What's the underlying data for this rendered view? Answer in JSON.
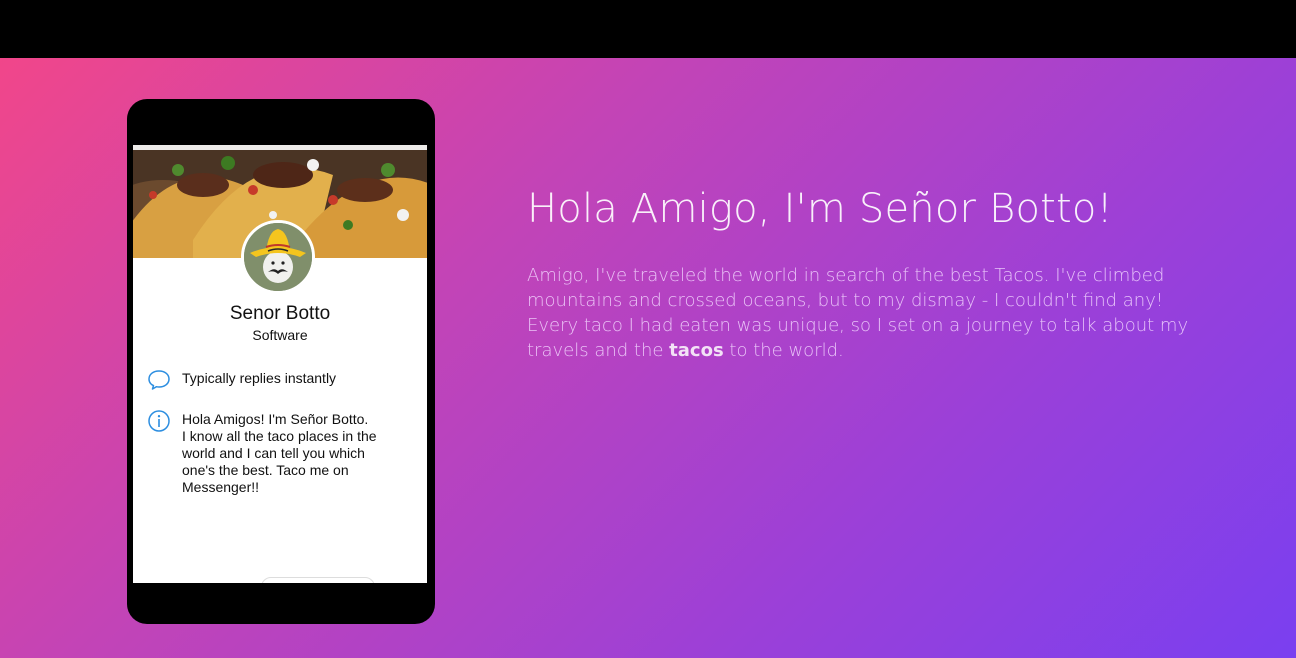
{
  "profile": {
    "name": "Senor Botto",
    "category": "Software",
    "avatar_caption": "Senor Botto"
  },
  "info": {
    "replies": "Typically replies instantly",
    "about": "Hola Amigos! I'm Señor Botto.\nI know all the taco places in the\nworld and I can tell you which\none's the best. Taco me on\nMessenger!!"
  },
  "hero": {
    "title": "Hola Amigo, I'm Señor Botto!",
    "body_before": "Amigo, I've traveled the world in search of the best Tacos. I've climbed mountains and crossed oceans, but to my dismay - I couldn't find any! Every taco I had eaten was unique, so I set on a journey to talk about my travels and the ",
    "body_emphasis": "tacos",
    "body_after": " to the world."
  },
  "icons": {
    "replies": "speech-bubble-icon",
    "about": "info-icon"
  },
  "colors": {
    "gradient_start": "#f1468a",
    "gradient_end": "#7a3ff0",
    "icon_blue": "#2d8ee0"
  }
}
